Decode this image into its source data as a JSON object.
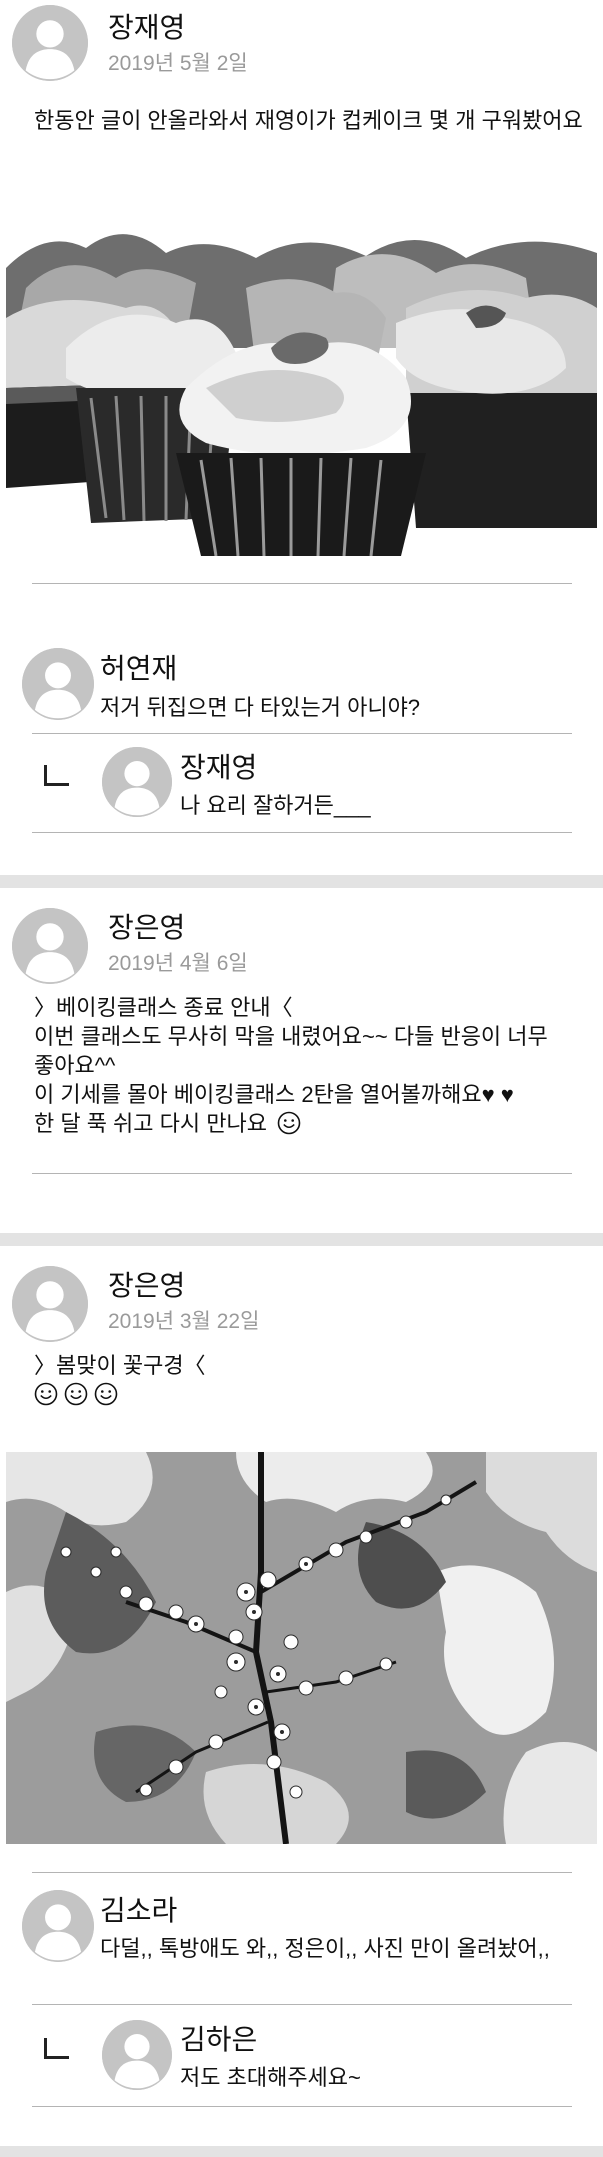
{
  "posts": [
    {
      "author": "장재영",
      "date": "2019년 5월 2일",
      "text": [
        "한동안 글이 안올라와서 재영이가 컵케이크 몇 개 구워봤어요"
      ],
      "photo_icon": "cupcakes-photo",
      "comments": [
        {
          "author": "허연재",
          "text": "저거 뒤집으면 다 타있는거 아니야?"
        }
      ],
      "replies": [
        {
          "author": "장재영",
          "text": "나 요리 잘하거든___"
        }
      ]
    },
    {
      "author": "장은영",
      "date": "2019년 4월 6일",
      "text": [
        "〉베이킹클래스 종료 안내〈",
        "이번 클래스도 무사히 막을 내렸어요~~ 다들 반응이 너무",
        "좋아요^^",
        "이 기세를 몰아 베이킹클래스 2탄을 열어볼까해요♥ ♥",
        "한 달 푹 쉬고 다시 만나요"
      ],
      "emoji_icon": "smiley-icon"
    },
    {
      "author": "장은영",
      "date": "2019년 3월 22일",
      "text": [
        "〉봄맞이 꽃구경〈"
      ],
      "emoji_count": 3,
      "photo_icon": "blossom-photo",
      "comments": [
        {
          "author": "김소라",
          "text": "다덜,, 톡방애도 와,, 정은이,, 사진 만이 올려놨어,,"
        }
      ],
      "replies": [
        {
          "author": "김하은",
          "text": "저도 초대해주세요~"
        }
      ]
    }
  ],
  "colors": {
    "separator": "#e3e3e3",
    "avatar": "#c4c4c4",
    "date_text": "#9a9a9a",
    "divider": "#b4b4b4"
  }
}
